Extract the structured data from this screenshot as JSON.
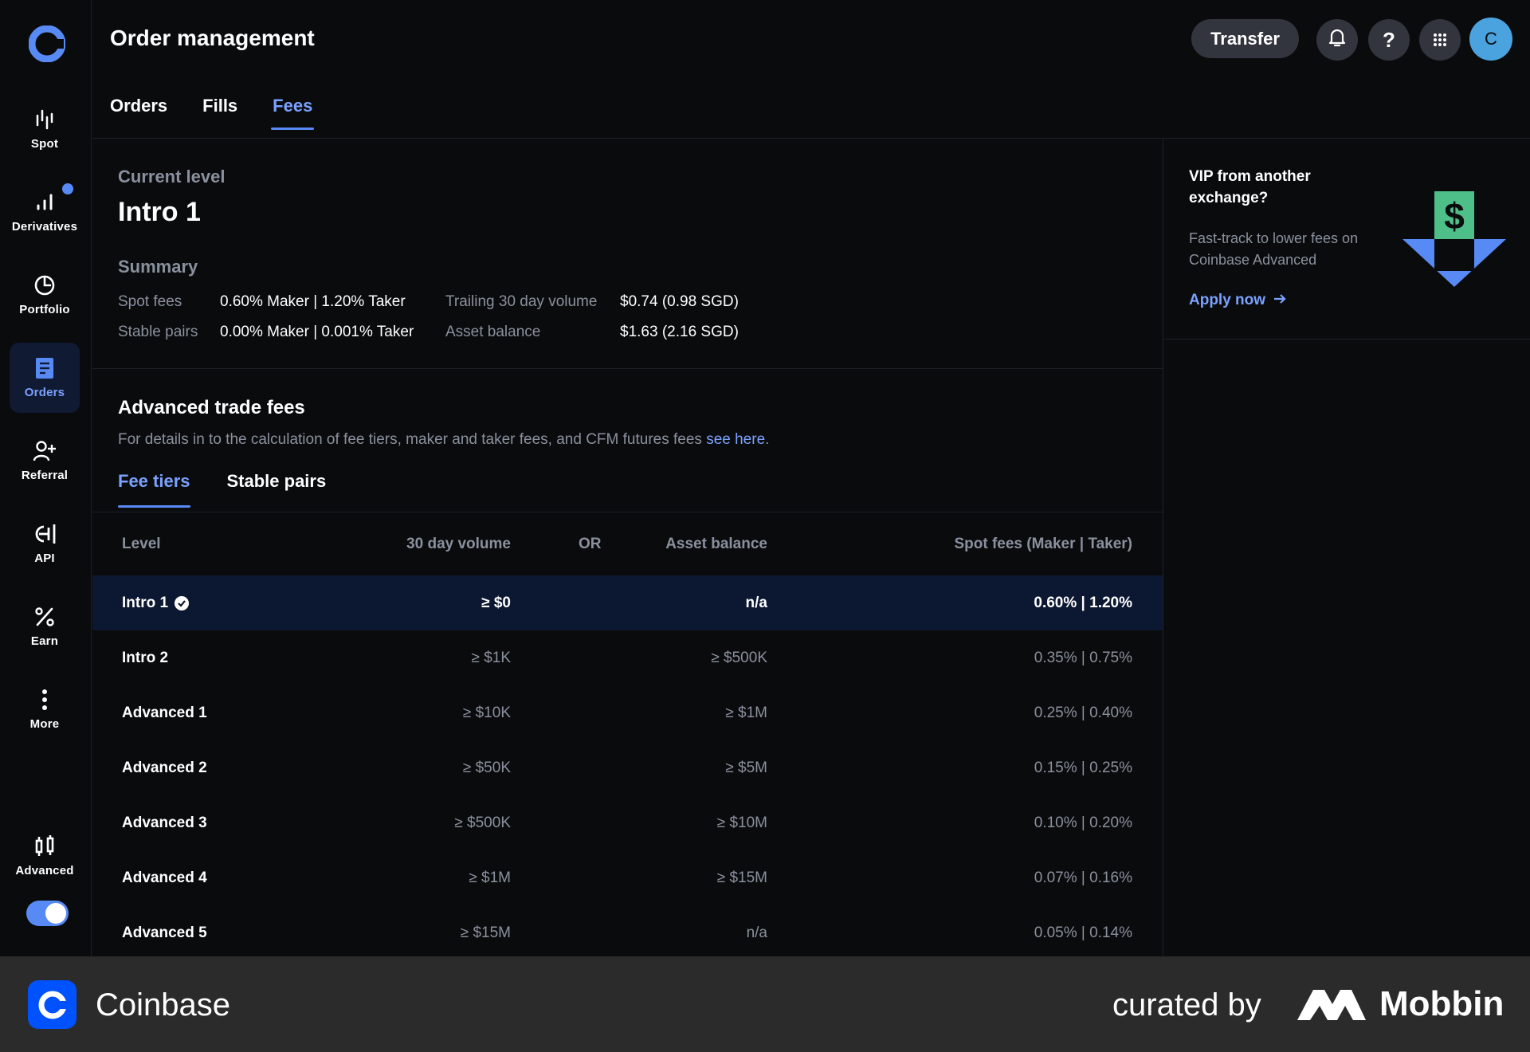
{
  "header": {
    "title": "Order management",
    "transfer_label": "Transfer",
    "avatar_initial": "C",
    "tabs": [
      {
        "label": "Orders",
        "active": false
      },
      {
        "label": "Fills",
        "active": false
      },
      {
        "label": "Fees",
        "active": true
      }
    ]
  },
  "sidebar": {
    "items": [
      {
        "label": "Spot",
        "icon": "spot-chart-icon"
      },
      {
        "label": "Derivatives",
        "icon": "bar-chart-icon"
      },
      {
        "label": "Portfolio",
        "icon": "pie-chart-icon"
      },
      {
        "label": "Orders",
        "icon": "document-icon",
        "active": true
      },
      {
        "label": "Referral",
        "icon": "add-user-icon"
      },
      {
        "label": "API",
        "icon": "api-icon"
      },
      {
        "label": "Earn",
        "icon": "percent-icon"
      },
      {
        "label": "More",
        "icon": "more-vertical-icon"
      }
    ],
    "advanced_label": "Advanced",
    "advanced_enabled": true
  },
  "current_level": {
    "label": "Current level",
    "value": "Intro 1"
  },
  "summary": {
    "title": "Summary",
    "spot_fees_label": "Spot fees",
    "spot_fees_value": "0.60% Maker | 1.20% Taker",
    "stable_pairs_label": "Stable pairs",
    "stable_pairs_value": "0.00% Maker | 0.001% Taker",
    "volume_label": "Trailing 30 day volume",
    "volume_value": "$0.74 (0.98 SGD)",
    "balance_label": "Asset balance",
    "balance_value": "$1.63 (2.16 SGD)"
  },
  "advanced_fees": {
    "title": "Advanced trade fees",
    "desc_prefix": "For details in to the calculation of fee tiers, maker and taker fees, and CFM futures fees ",
    "desc_link": "see here",
    "desc_suffix": ".",
    "sub_tabs": [
      {
        "label": "Fee tiers",
        "active": true
      },
      {
        "label": "Stable pairs",
        "active": false
      }
    ]
  },
  "fee_table": {
    "headers": {
      "level": "Level",
      "volume": "30 day volume",
      "or": "OR",
      "asset": "Asset balance",
      "fees": "Spot fees (Maker | Taker)"
    },
    "rows": [
      {
        "level": "Intro 1",
        "volume": "≥ $0",
        "asset": "n/a",
        "fees": "0.60% | 1.20%",
        "current": true
      },
      {
        "level": "Intro 2",
        "volume": "≥ $1K",
        "asset": "≥ $500K",
        "fees": "0.35% | 0.75%"
      },
      {
        "level": "Advanced 1",
        "volume": "≥ $10K",
        "asset": "≥ $1M",
        "fees": "0.25% | 0.40%"
      },
      {
        "level": "Advanced 2",
        "volume": "≥ $50K",
        "asset": "≥ $5M",
        "fees": "0.15% | 0.25%"
      },
      {
        "level": "Advanced 3",
        "volume": "≥ $500K",
        "asset": "≥ $10M",
        "fees": "0.10% | 0.20%"
      },
      {
        "level": "Advanced 4",
        "volume": "≥ $1M",
        "asset": "≥ $15M",
        "fees": "0.07% | 0.16%"
      },
      {
        "level": "Advanced 5",
        "volume": "≥ $15M",
        "asset": "n/a",
        "fees": "0.05% | 0.14%"
      }
    ]
  },
  "vip_card": {
    "title": "VIP from another exchange?",
    "description": "Fast-track to lower fees on Coinbase Advanced",
    "cta": "Apply now"
  },
  "footer": {
    "brand": "Coinbase",
    "curated_by": "curated by",
    "curator": "Mobbin"
  },
  "colors": {
    "background": "#0a0b0d",
    "accent": "#588af5",
    "accent_text": "#7ba1ff",
    "muted_text": "#8a919e",
    "highlight_row": "#0c1731",
    "button_bg": "#32353d",
    "avatar_bg": "#4aa3df",
    "footer_bg": "#2b2b2b"
  }
}
